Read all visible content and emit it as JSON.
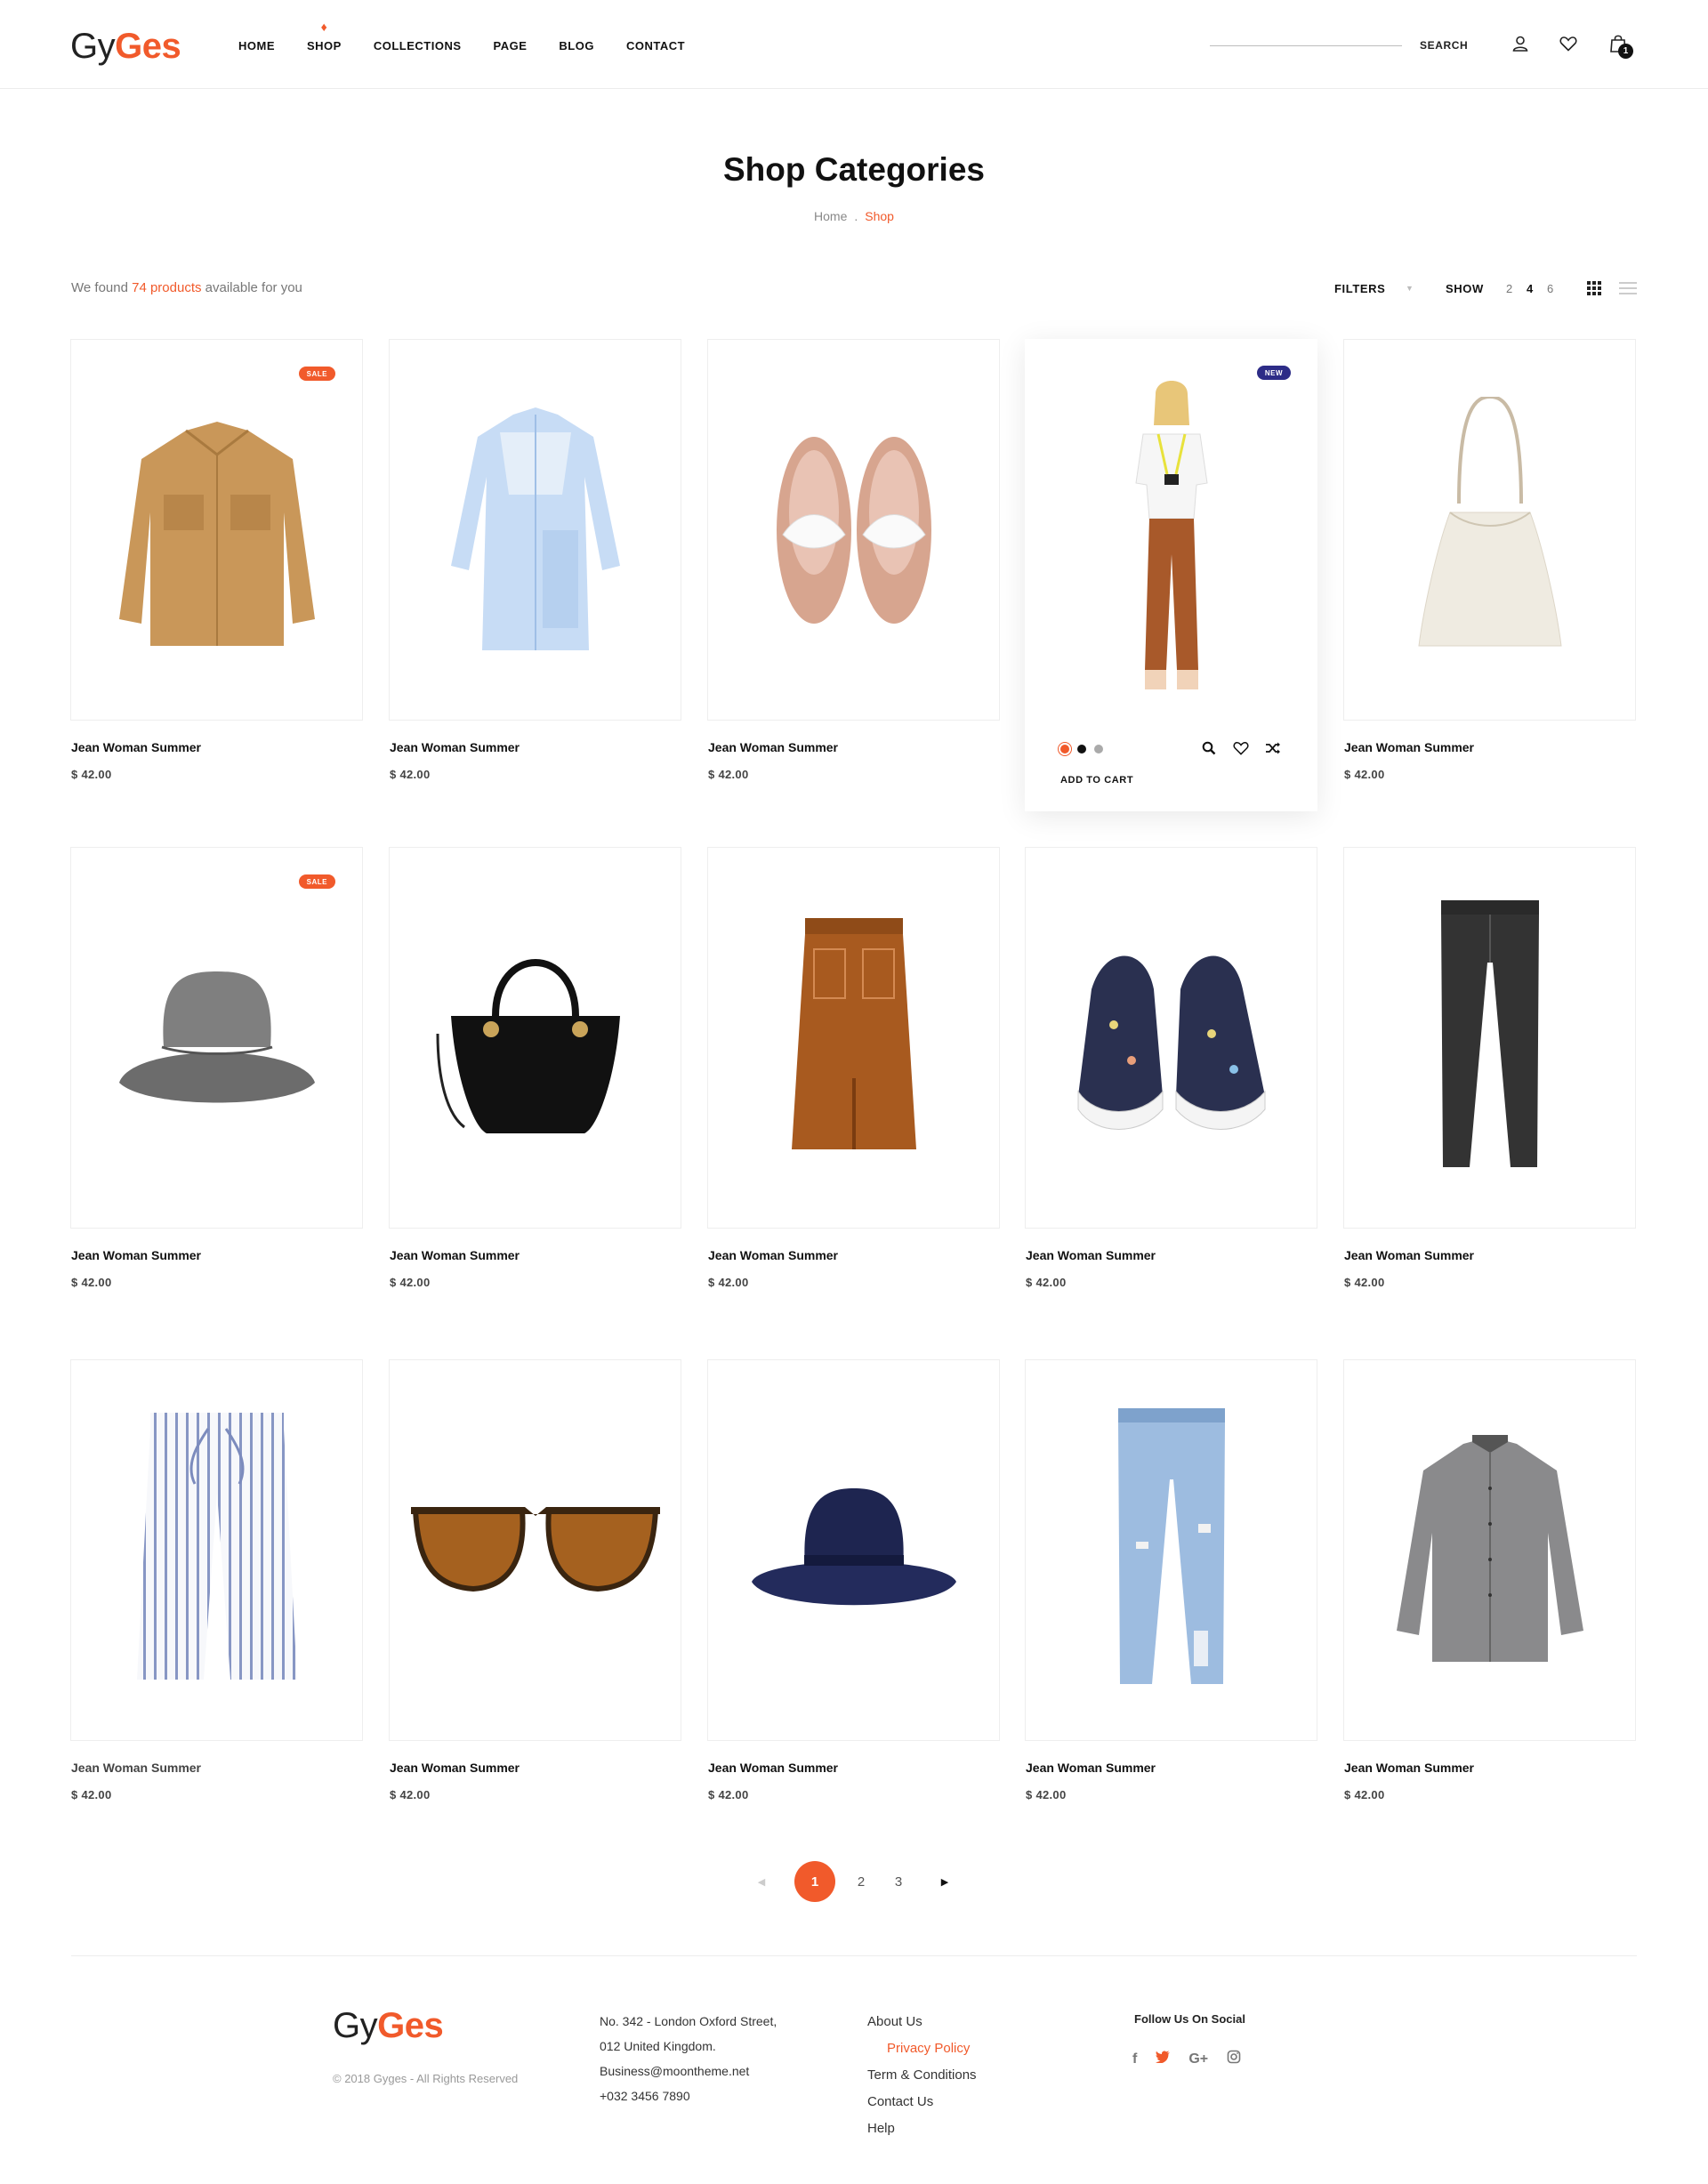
{
  "header": {
    "logo_a": "Gy",
    "logo_b": "Ges",
    "nav": [
      "HOME",
      "SHOP",
      "COLLECTIONS",
      "PAGE",
      "BLOG",
      "CONTACT"
    ],
    "search_label": "SEARCH",
    "cart_count": "1"
  },
  "page": {
    "title": "Shop Categories",
    "breadcrumb_home": "Home",
    "breadcrumb_sep": ".",
    "breadcrumb_current": "Shop"
  },
  "toolbar": {
    "found_prefix": "We found ",
    "found_count": "74 products",
    "found_suffix": " available for you",
    "filters": "FILTERS",
    "show": "SHOW",
    "show_options": [
      "2",
      "4",
      "6"
    ],
    "show_active": "4"
  },
  "products": [
    {
      "name": "Jean Woman Summer",
      "price": "$ 42.00",
      "badge": "SALE",
      "item": "shirt-tan-icon"
    },
    {
      "name": "Jean Woman Summer",
      "price": "$ 42.00",
      "badge": "",
      "item": "shirt-dress-blue-icon"
    },
    {
      "name": "Jean Woman Summer",
      "price": "$ 42.00",
      "badge": "",
      "item": "sneakers-pink-icon"
    },
    {
      "name": "Jean Woman Summer",
      "price": "$ 42.00",
      "badge": "NEW",
      "item": "model-outfit-icon",
      "add_to_cart": "ADD TO CART",
      "swatches": [
        "#f15a2b",
        "#111111",
        "#aaaaaa"
      ]
    },
    {
      "name": "Jean Woman Summer",
      "price": "$ 42.00",
      "badge": "",
      "item": "tote-bag-icon"
    },
    {
      "name": "Jean Woman Summer",
      "price": "$ 42.00",
      "badge": "SALE",
      "item": "bucket-hat-icon"
    },
    {
      "name": "Jean Woman Summer",
      "price": "$ 42.00",
      "badge": "",
      "item": "black-handbag-icon"
    },
    {
      "name": "Jean Woman Summer",
      "price": "$ 42.00",
      "badge": "",
      "item": "skirt-rust-icon"
    },
    {
      "name": "Jean Woman Summer",
      "price": "$ 42.00",
      "badge": "",
      "item": "sneakers-floral-icon"
    },
    {
      "name": "Jean Woman Summer",
      "price": "$ 42.00",
      "badge": "",
      "item": "black-jeans-icon"
    },
    {
      "name": "Jean Woman Summer",
      "price": "$ 42.00",
      "badge": "",
      "item": "striped-trousers-icon"
    },
    {
      "name": "Jean Woman Summer",
      "price": "$ 42.00",
      "badge": "",
      "item": "sunglasses-icon"
    },
    {
      "name": "Jean Woman Summer",
      "price": "$ 42.00",
      "badge": "",
      "item": "fedora-hat-icon"
    },
    {
      "name": "Jean Woman Summer",
      "price": "$ 42.00",
      "badge": "",
      "item": "ripped-jeans-icon"
    },
    {
      "name": "Jean Woman Summer",
      "price": "$ 42.00",
      "badge": "",
      "item": "grey-shirt-icon"
    }
  ],
  "pagination": {
    "pages": [
      "1",
      "2",
      "3"
    ],
    "active": "1"
  },
  "footer": {
    "logo_a": "Gy",
    "logo_b": "Ges",
    "copyright": "© 2018 Gyges - All Rights Reserved",
    "address": [
      "No. 342 - London Oxford Street,",
      "012 United Kingdom.",
      "Business@moontheme.net",
      "+032 3456 7890"
    ],
    "links": [
      "About Us",
      "Privacy Policy",
      "Term & Conditions",
      "Contact Us",
      "Help"
    ],
    "social_title": "Follow Us On Social",
    "socials": [
      "f",
      "t",
      "G+",
      "ig"
    ]
  },
  "colors": {
    "accent": "#f15a2b",
    "new_badge": "#2d2c87"
  }
}
